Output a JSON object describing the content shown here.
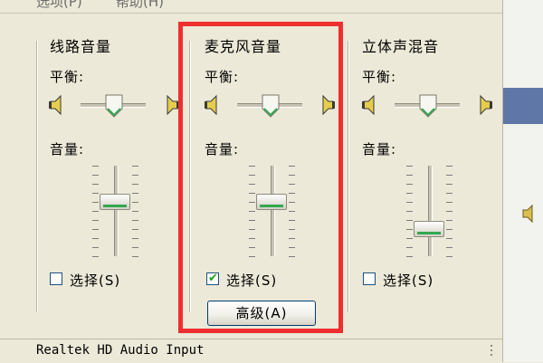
{
  "menu": [
    {
      "label": "选项(P)"
    },
    {
      "label": "帮助(H)"
    }
  ],
  "panels": [
    {
      "title": "线路音量",
      "balance_label": "平衡:",
      "volume_label": "音量:",
      "balance_value": 0.5,
      "volume_value": 0.6,
      "select_label": "选择(S)",
      "selected": false
    },
    {
      "title": "麦克风音量",
      "balance_label": "平衡:",
      "volume_label": "音量:",
      "balance_value": 0.5,
      "volume_value": 0.6,
      "select_label": "选择(S)",
      "selected": true,
      "advanced_label": "高级(A)"
    },
    {
      "title": "立体声混音",
      "balance_label": "平衡:",
      "volume_label": "音量:",
      "balance_value": 0.5,
      "volume_value": 0.3,
      "select_label": "选择(S)",
      "selected": false
    }
  ],
  "status": {
    "device": "Realtek HD Audio Input"
  },
  "colors": {
    "highlight": "#ef2f2f",
    "accent_green": "#34a852",
    "window_bg": "#ece9d8"
  }
}
